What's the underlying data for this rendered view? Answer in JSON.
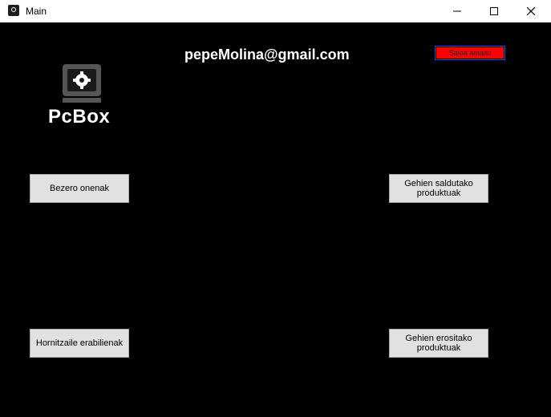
{
  "window": {
    "title": "Main"
  },
  "header": {
    "user_email": "pepeMolina@gmail.com",
    "logout_label": "Saioa amaitu"
  },
  "logo": {
    "text": "PcBox"
  },
  "buttons": {
    "best_customers": "Bezero onenak",
    "most_sold_products_line1": "Gehien saldutako",
    "most_sold_products_line2": "produktuak",
    "most_used_suppliers": "Hornitzaile erabilienak",
    "most_bought_products_line1": "Gehien erositako",
    "most_bought_products_line2": "produktuak"
  },
  "colors": {
    "background": "#000000",
    "logout_bg": "#ff0000",
    "button_bg": "#e1e1e1"
  }
}
